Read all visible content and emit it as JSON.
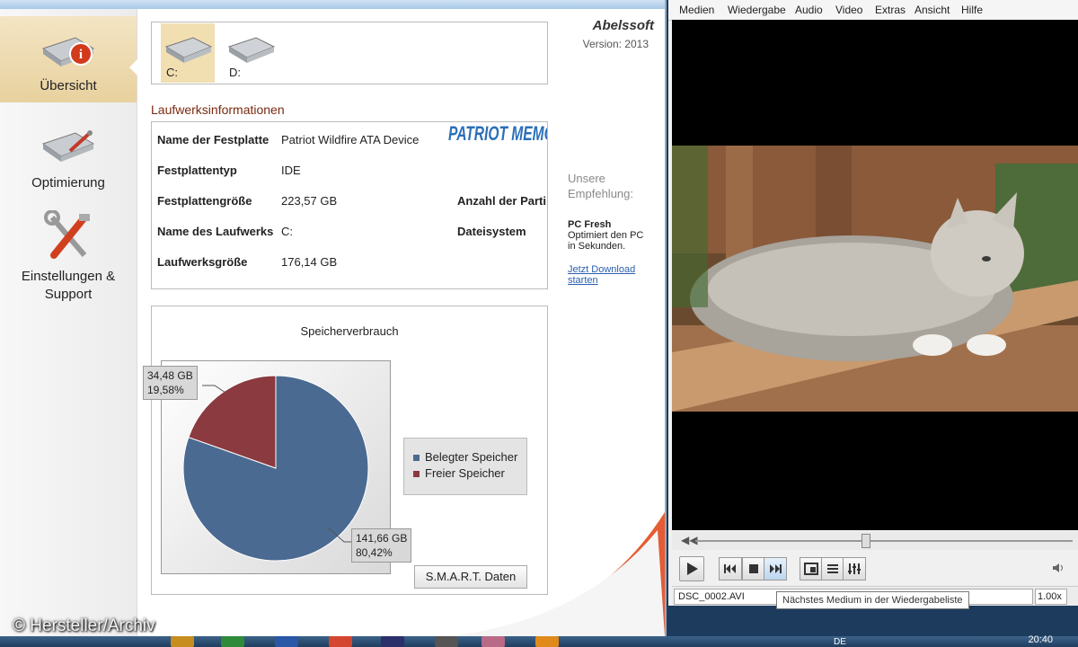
{
  "app": {
    "brand": "Abelssoft",
    "version": "Version: 2013",
    "sidebar": [
      {
        "label": "Übersicht"
      },
      {
        "label": "Optimierung"
      },
      {
        "label": "Einstellungen & Support"
      }
    ],
    "drives": [
      {
        "letter": "C:"
      },
      {
        "letter": "D:"
      }
    ],
    "section_title": "Laufwerksinformationen",
    "manufacturer_logo": "PATRIOT MEMORY",
    "info": {
      "disk_name_label": "Name der Festplatte",
      "disk_name_value": "Patriot Wildfire ATA Device",
      "disk_type_label": "Festplattentyp",
      "disk_type_value": "IDE",
      "disk_size_label": "Festplattengröße",
      "disk_size_value": "223,57 GB",
      "partitions_label": "Anzahl der Parti",
      "drive_name_label": "Name des Laufwerks",
      "drive_name_value": "C:",
      "filesystem_label": "Dateisystem",
      "drive_size_label": "Laufwerksgröße",
      "drive_size_value": "176,14 GB"
    },
    "smart_button": "S.M.A.R.T. Daten",
    "recommendation": {
      "heading_1": "Unsere",
      "heading_2": "Empfehlung:",
      "product": "PC Fresh",
      "desc_1": "Optimiert den PC",
      "desc_2": "in Sekunden.",
      "link_1": "Jetzt Download",
      "link_2": "starten"
    },
    "colors": {
      "used": "#4a6a91",
      "free": "#8b3a3f",
      "accent": "#f1dfb2",
      "section": "#7a2a10"
    }
  },
  "chart_data": {
    "type": "pie",
    "title": "Speicherverbrauch",
    "categories": [
      "Belegter Speicher",
      "Freier Speicher"
    ],
    "values": [
      141.66,
      34.48
    ],
    "percentages": [
      80.42,
      19.58
    ],
    "labels": [
      {
        "gb": "141,66 GB",
        "pct": "80,42%"
      },
      {
        "gb": "34,48 GB",
        "pct": "19,58%"
      }
    ],
    "colors": [
      "#4a6a91",
      "#8b3a3f"
    ],
    "legend": "right"
  },
  "player": {
    "menu": [
      "Medien",
      "Wiedergabe",
      "Audio",
      "Video",
      "Extras",
      "Ansicht",
      "Hilfe"
    ],
    "filename": "DSC_0002.AVI",
    "speed": "1.00x",
    "tooltip": "Nächstes Medium in der Wiedergabeliste",
    "seek_position": 0.45
  },
  "taskbar": {
    "lang": "DE",
    "clock": "20:40"
  },
  "credit": "© Hersteller/Archiv"
}
